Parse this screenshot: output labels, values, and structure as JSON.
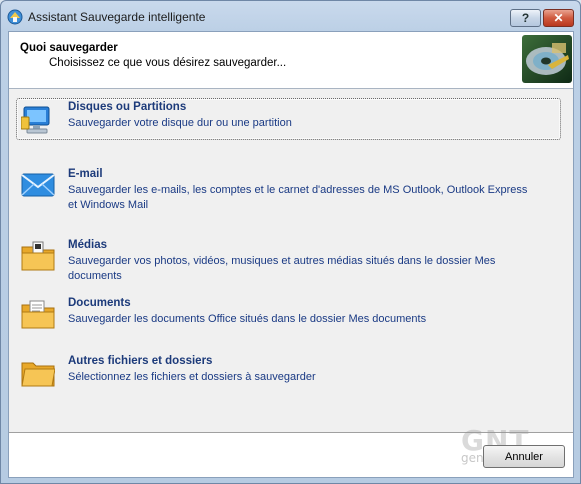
{
  "window": {
    "title": "Assistant Sauvegarde intelligente",
    "help_label": "?",
    "close_label": "✕"
  },
  "header": {
    "title": "Quoi sauvegarder",
    "subtitle": "Choisissez ce que vous désirez sauvegarder..."
  },
  "options": [
    {
      "title": "Disques ou Partitions",
      "desc": "Sauvegarder votre disque dur ou une partition",
      "icon": "computer-icon",
      "selected": true
    },
    {
      "title": "E-mail",
      "desc": "Sauvegarder les e-mails, les comptes et le carnet d'adresses de MS Outlook, Outlook Express et Windows Mail",
      "icon": "envelope-icon",
      "selected": false
    },
    {
      "title": "Médias",
      "desc": "Sauvegarder vos photos, vidéos, musiques et autres médias situés dans le dossier Mes documents",
      "icon": "media-folder-icon",
      "selected": false
    },
    {
      "title": "Documents",
      "desc": "Sauvegarder les documents Office situés dans le dossier Mes documents",
      "icon": "documents-folder-icon",
      "selected": false
    },
    {
      "title": "Autres fichiers et dossiers",
      "desc": "Sélectionnez les fichiers et dossiers à sauvegarder",
      "icon": "folder-icon",
      "selected": false
    }
  ],
  "footer": {
    "cancel_label": "Annuler"
  },
  "watermark": {
    "logo": "GNT",
    "site": "generation"
  },
  "colors": {
    "option_title": "#1c3a7a",
    "option_desc": "#1a3a84",
    "close_button": "#cf5a3f"
  }
}
